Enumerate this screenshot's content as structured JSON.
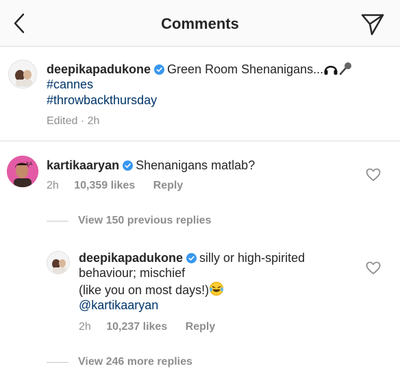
{
  "header": {
    "title": "Comments",
    "back_icon": "chevron-left-icon",
    "share_icon": "paper-plane-icon"
  },
  "caption": {
    "username": "deepikapadukone",
    "text": "Green Room Shenanigans...",
    "emojis": [
      "headphones-icon",
      "microphone-icon"
    ],
    "hashtags": [
      "#cannes",
      "#throwbackthursday"
    ],
    "edited": "Edited",
    "time": "2h"
  },
  "comment": {
    "username": "kartikaaryan",
    "text": "Shenanigans matlab?",
    "time": "2h",
    "likes": "10,359 likes",
    "reply": "Reply",
    "view_previous": "View 150 previous replies"
  },
  "reply": {
    "username": "deepikapadukone",
    "text_line1": "silly or high-spirited",
    "text_line2": "behaviour; mischief",
    "text_line3": "(like you on most days!)",
    "emoji": "laughing-tears-icon",
    "mention": "@kartikaaryan",
    "time": "2h",
    "likes": "10,237 likes",
    "reply": "Reply",
    "view_more": "View 246 more replies"
  },
  "colors": {
    "verified": "#3897f0",
    "link": "#003569",
    "muted": "#8e8e8e",
    "avatar_bg": "#e35ba4"
  }
}
